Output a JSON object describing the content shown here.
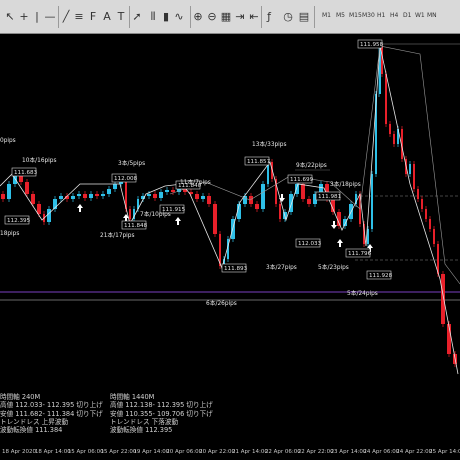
{
  "toolbar": {
    "timeframes": [
      "M1",
      "M5",
      "M15",
      "M30",
      "H1",
      "H4",
      "D1",
      "W1",
      "MN"
    ],
    "icons": [
      "pointer-icon",
      "crosshair-icon",
      "vertical-line-icon",
      "horizontal-line-icon",
      "trendline-icon",
      "channel-icon",
      "fibonacci-icon",
      "text-icon",
      "label-icon",
      "arrow-icon",
      "bar-chart-icon",
      "candle-chart-icon",
      "line-chart-icon",
      "zoom-in-icon",
      "zoom-out-icon",
      "tile-icon",
      "autoscroll-icon",
      "chart-shift-icon",
      "indicators-icon",
      "period-icon",
      "template-icon"
    ]
  },
  "chart": {
    "price_labels": [
      "112.395",
      "112.008",
      "111.848",
      "111.915",
      "111.840",
      "111.893",
      "111.857",
      "111.699",
      "112.033",
      "111.981",
      "111.796",
      "111.928",
      "111.958",
      "111.683"
    ],
    "wave_labels": [
      "10本/16pips",
      "3本/5pips",
      "11本/7pips",
      "7本/10pips",
      "21本/17pips",
      "13本/33pips",
      "9本/22pips",
      "3本/18pips",
      "3本/27pips",
      "5本/23pips",
      "6本/26pips",
      "5本/24pips",
      "18pips",
      "0pips"
    ]
  },
  "axis_labels": [
    "18 Apr 2020",
    "18 Apr 14:00",
    "15 Apr 06:00",
    "15 Apr 22:00",
    "19 Apr 14:00",
    "20 Apr 06:00",
    "20 Apr 22:00",
    "21 Apr 14:00",
    "22 Apr 06:00",
    "22 Apr 22:00",
    "23 Apr 14:00",
    "24 Apr 06:00",
    "24 Apr 22:00",
    "25 Apr 14:00"
  ],
  "info_left": [
    "時間軸 240M",
    "高値 112.033- 112.395 切り上げ",
    "安値 111.682- 111.384 切り下げ",
    "トレンドレス 上昇波動",
    "波動転換値 111.384"
  ],
  "info_right": [
    "時間軸 1440M",
    "高値 112.138- 112.395 切り上げ",
    "安値 110.355- 109.706 切り下げ",
    "トレンドレス 下落波動",
    "波動転換値 112.395"
  ],
  "colors": {
    "bull": "#2ec0e8",
    "bear": "#e8202a",
    "wave": "#e6e6e6",
    "purple": "#7a3fbf",
    "bg": "#000000"
  }
}
